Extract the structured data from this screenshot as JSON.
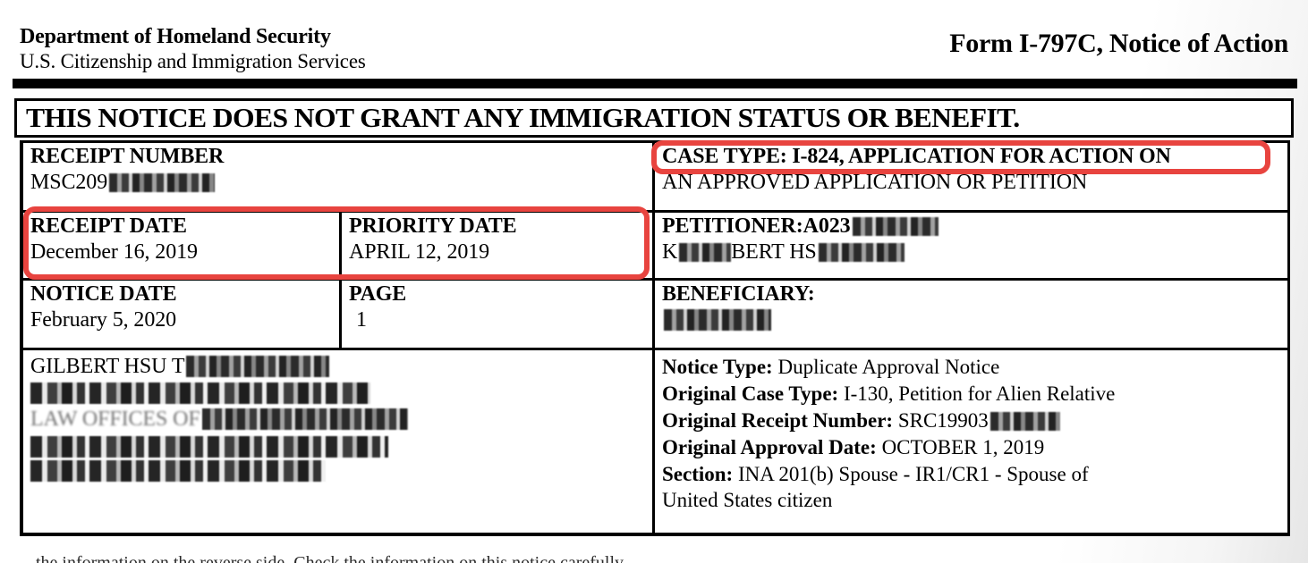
{
  "document": {
    "agency_line1": "Department of Homeland Security",
    "agency_line2": "U.S. Citizenship and Immigration Services",
    "form_title": "Form I-797C, Notice of Action",
    "banner": "THIS NOTICE DOES NOT GRANT ANY IMMIGRATION STATUS OR BENEFIT.",
    "footer_cutoff": "the information on the reverse side. Check the information on this notice carefully."
  },
  "fields": {
    "receipt_number_label": "RECEIPT NUMBER",
    "receipt_number_value": "MSC209",
    "case_type_label_line1": "CASE TYPE: I-824, APPLICATION FOR ACTION ON",
    "case_type_label_line2": "AN APPROVED APPLICATION OR PETITION",
    "receipt_date_label": "RECEIPT DATE",
    "receipt_date_value": "December 16, 2019",
    "priority_date_label": "PRIORITY DATE",
    "priority_date_value": "APRIL 12, 2019",
    "petitioner_label": "PETITIONER:A023",
    "petitioner_name_prefix": "K",
    "petitioner_name_mid": "BERT HS",
    "notice_date_label": "NOTICE DATE",
    "notice_date_value": "February 5, 2020",
    "page_label": "PAGE",
    "page_value": "1",
    "beneficiary_label": "BENEFICIARY:"
  },
  "address_block": {
    "line1": "GILBERT HSU T",
    "line3_prefix": "LAW OFFICES OF"
  },
  "notice_details": {
    "notice_type_label": "Notice Type:",
    "notice_type_value": "Duplicate Approval Notice",
    "original_case_type_label": "Original Case Type:",
    "original_case_type_value": "I-130, Petition for Alien Relative",
    "original_receipt_number_label": "Original Receipt Number:",
    "original_receipt_number_value": "SRC19903",
    "original_approval_date_label": "Original Approval Date:",
    "original_approval_date_value": "OCTOBER 1, 2019",
    "section_label": "Section:",
    "section_value_line1": "INA 201(b) Spouse - IR1/CR1 - Spouse of",
    "section_value_line2": "United States citizen"
  },
  "annotations": {
    "highlight_color": "#e8443f",
    "boxes": [
      {
        "name": "case-type-highlight"
      },
      {
        "name": "dates-highlight"
      }
    ]
  }
}
